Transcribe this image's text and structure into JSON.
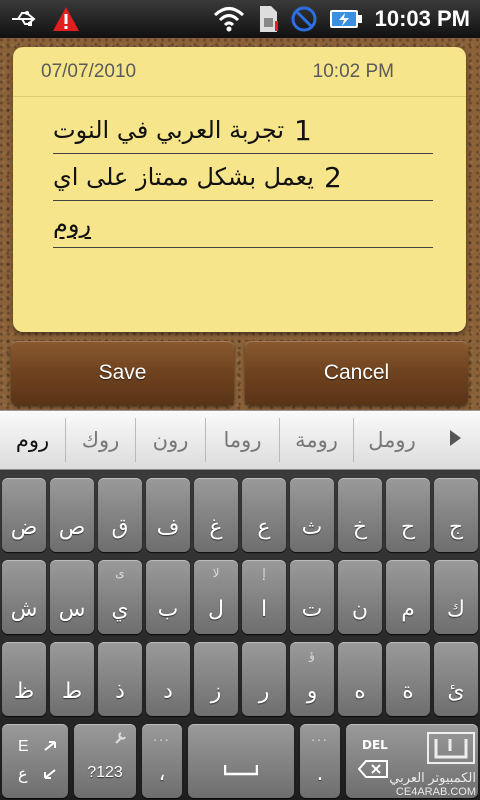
{
  "status_bar": {
    "time": "10:03 PM",
    "icons": [
      "usb-icon",
      "warning-icon",
      "wifi-icon",
      "sim-icon",
      "no-sync-icon",
      "battery-charging-icon"
    ]
  },
  "note": {
    "date": "07/07/2010",
    "time": "10:02 PM",
    "lines": [
      {
        "number": "1",
        "text": "تجربة العربي في النوت"
      },
      {
        "number": "2",
        "text": "يعمل بشكل ممتاز على اي"
      },
      {
        "number": "",
        "text": "روم"
      }
    ]
  },
  "buttons": {
    "save": "Save",
    "cancel": "Cancel"
  },
  "suggestions": [
    "روم",
    "روك",
    "رون",
    "روما",
    "رومة",
    "رومل"
  ],
  "keyboard": {
    "row1": [
      "ض",
      "ص",
      "ق",
      "ف",
      "غ",
      "ع",
      "ث",
      "خ",
      "ح",
      "ج"
    ],
    "row2": [
      {
        "main": "ش",
        "alt": ""
      },
      {
        "main": "س",
        "alt": ""
      },
      {
        "main": "ي",
        "alt": "ى"
      },
      {
        "main": "ب",
        "alt": ""
      },
      {
        "main": "ل",
        "alt": "لا"
      },
      {
        "main": "ا",
        "alt": "إ"
      },
      {
        "main": "ت",
        "alt": ""
      },
      {
        "main": "ن",
        "alt": ""
      },
      {
        "main": "م",
        "alt": ""
      },
      {
        "main": "ك",
        "alt": ""
      }
    ],
    "row3": [
      {
        "main": "ظ",
        "alt": ""
      },
      {
        "main": "ط",
        "alt": ""
      },
      {
        "main": "ذ",
        "alt": ""
      },
      {
        "main": "د",
        "alt": ""
      },
      {
        "main": "ز",
        "alt": ""
      },
      {
        "main": "ر",
        "alt": ""
      },
      {
        "main": "و",
        "alt": "ؤ"
      },
      {
        "main": "ه",
        "alt": ""
      },
      {
        "main": "ة",
        "alt": ""
      },
      {
        "main": "ئ",
        "alt": ""
      }
    ],
    "row4": {
      "lang_top": "E",
      "lang_bottom": "ع",
      "symbols": "?123",
      "comma": "،",
      "space": "",
      "period": ".",
      "delete": "DEL"
    }
  },
  "watermark": {
    "arabic": "الكمبيوتر العربي",
    "latin": "CE4ARAB.COM"
  }
}
